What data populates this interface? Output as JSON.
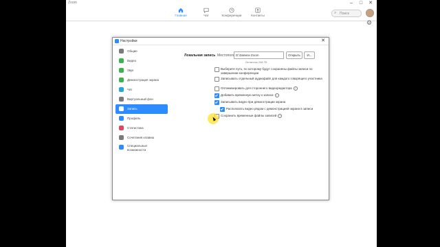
{
  "window": {
    "title": "Zoom"
  },
  "topnav": {
    "tabs": [
      {
        "label": "Главная",
        "icon": "home-icon",
        "active": true
      },
      {
        "label": "Чат",
        "icon": "chat-icon",
        "active": false
      },
      {
        "label": "Конференции",
        "icon": "clock-icon",
        "active": false
      },
      {
        "label": "Контакты",
        "icon": "contacts-icon",
        "active": false
      }
    ],
    "search_placeholder": "Поиск"
  },
  "dialog": {
    "title": "Настройки",
    "sidebar": [
      {
        "label": "Общие",
        "icon": "gear-icon",
        "color": "#7a7a7a"
      },
      {
        "label": "Видео",
        "icon": "video-icon",
        "color": "#3ab34a"
      },
      {
        "label": "Звук",
        "icon": "headphones-icon",
        "color": "#3ab34a"
      },
      {
        "label": "Демонстрация экрана",
        "icon": "share-screen-icon",
        "color": "#3ab34a"
      },
      {
        "label": "Чат",
        "icon": "chat-icon",
        "color": "#1ea7e0"
      },
      {
        "label": "Виртуальный фон",
        "icon": "person-icon",
        "color": "#7a7a7a"
      },
      {
        "label": "Запись",
        "icon": "record-icon",
        "color": "#ffffff",
        "active": true
      },
      {
        "label": "Профиль",
        "icon": "profile-icon",
        "color": "#2D8CFF"
      },
      {
        "label": "Статистика",
        "icon": "stats-icon",
        "color": "#e0485a"
      },
      {
        "label": "Сочетания клавиш",
        "icon": "keyboard-icon",
        "color": "#7a7a7a"
      },
      {
        "label": "Специальные возможности",
        "icon": "accessibility-icon",
        "color": "#2D8CFF"
      }
    ],
    "recording": {
      "section_title": "Локальная запись",
      "location_label": "Местоположение:",
      "location_value": "D:\\Записи Zoom",
      "open_button": "Открыть",
      "change_button": "И...",
      "remaining": "Осталось 248 ГБ",
      "options": [
        {
          "text": "Выберите путь, по которому будут сохранены файлы записи по завершении конференции",
          "checked": false,
          "indent": false,
          "help": false
        },
        {
          "text": "Записывать отдельный аудиофайл для каждого говорящего участника",
          "checked": false,
          "indent": false,
          "help": false
        },
        {
          "text": "Оптимизировать для стороннего видеоредактора",
          "checked": false,
          "indent": false,
          "help": true
        },
        {
          "text": "Добавить временную метку к записи",
          "checked": true,
          "indent": false,
          "help": true
        },
        {
          "text": "Записывать видео при демонстрации экрана",
          "checked": true,
          "indent": false,
          "help": false
        },
        {
          "text": "Располагать видео рядом с демонстрацией экрана в записи",
          "checked": true,
          "indent": true,
          "help": false
        },
        {
          "text": "Сохранить временные файлы записей",
          "checked": false,
          "indent": false,
          "help": true
        }
      ]
    }
  }
}
